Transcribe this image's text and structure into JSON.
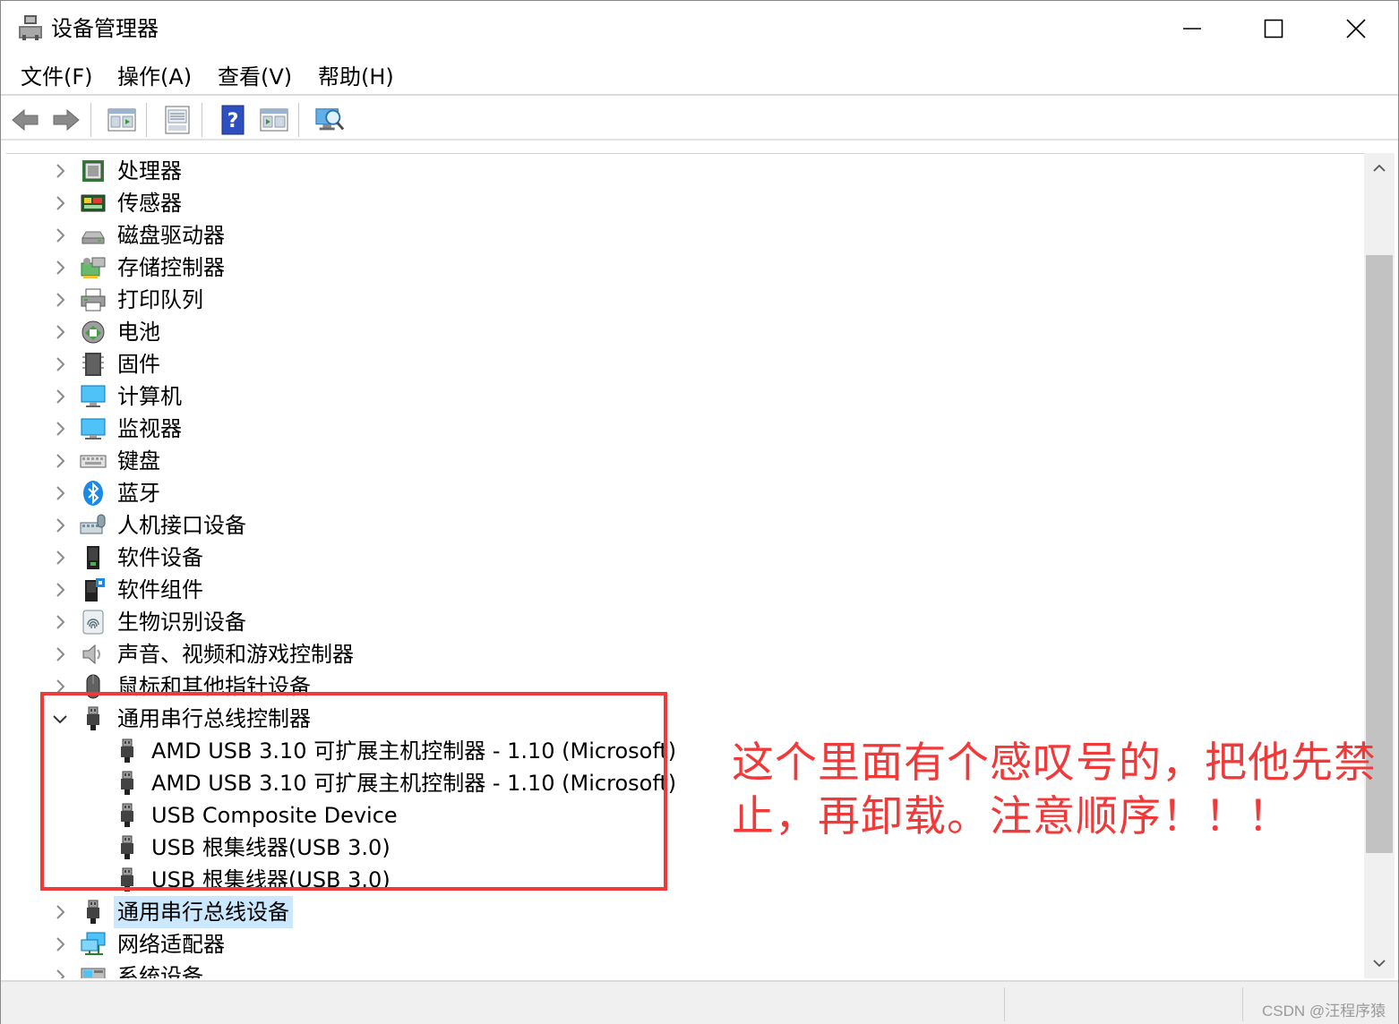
{
  "window": {
    "title": "设备管理器"
  },
  "menu": [
    "文件(F)",
    "操作(A)",
    "查看(V)",
    "帮助(H)"
  ],
  "toolbar": [
    "back-icon",
    "forward-icon",
    "properties-icon",
    "update-icon",
    "help-icon",
    "view-icon",
    "scan-hardware-icon"
  ],
  "tree": {
    "categories_top": [
      {
        "label": "处理器",
        "icon": "processor-icon"
      },
      {
        "label": "传感器",
        "icon": "sensor-icon"
      },
      {
        "label": "磁盘驱动器",
        "icon": "disk-drive-icon"
      },
      {
        "label": "存储控制器",
        "icon": "storage-controller-icon"
      },
      {
        "label": "打印队列",
        "icon": "printer-icon"
      },
      {
        "label": "电池",
        "icon": "battery-icon"
      },
      {
        "label": "固件",
        "icon": "firmware-icon"
      },
      {
        "label": "计算机",
        "icon": "computer-icon"
      },
      {
        "label": "监视器",
        "icon": "monitor-icon"
      },
      {
        "label": "键盘",
        "icon": "keyboard-icon"
      },
      {
        "label": "蓝牙",
        "icon": "bluetooth-icon"
      },
      {
        "label": "人机接口设备",
        "icon": "hid-icon"
      },
      {
        "label": "软件设备",
        "icon": "software-device-icon"
      },
      {
        "label": "软件组件",
        "icon": "software-component-icon"
      },
      {
        "label": "生物识别设备",
        "icon": "biometric-icon"
      },
      {
        "label": "声音、视频和游戏控制器",
        "icon": "speaker-icon"
      },
      {
        "label": "鼠标和其他指针设备",
        "icon": "mouse-icon"
      }
    ],
    "expanded": {
      "label": "通用串行总线控制器",
      "children": [
        "AMD USB 3.10 可扩展主机控制器 - 1.10 (Microsoft)",
        "AMD USB 3.10 可扩展主机控制器 - 1.10 (Microsoft)",
        "USB Composite Device",
        "USB 根集线器(USB 3.0)",
        "USB 根集线器(USB 3.0)"
      ]
    },
    "categories_bottom": [
      {
        "label": "通用串行总线设备",
        "icon": "usb-icon",
        "selected": true
      },
      {
        "label": "网络适配器",
        "icon": "network-adapter-icon"
      },
      {
        "label": "系统设备",
        "icon": "system-device-icon"
      }
    ]
  },
  "annotation": {
    "line1": "这个里面有个感叹号的，把他先禁",
    "line2": "止，再卸载。注意顺序！！！",
    "color": "#f03a3a"
  },
  "watermark": "CSDN @汪程序猿"
}
